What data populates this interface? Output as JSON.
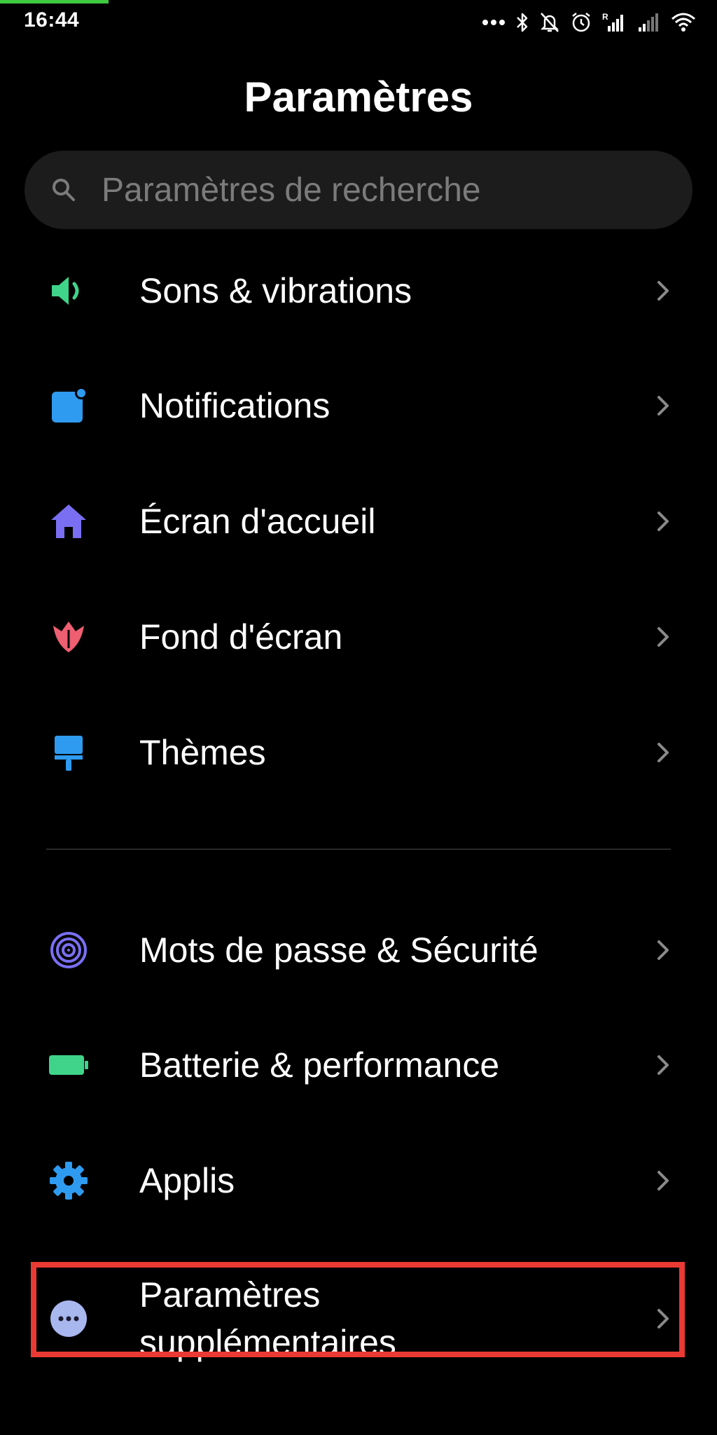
{
  "status_bar": {
    "time": "16:44",
    "icons": [
      "more-dots-icon",
      "bluetooth-icon",
      "bell-off-icon",
      "alarm-icon",
      "signal-r-icon",
      "signal-icon",
      "wifi-icon"
    ]
  },
  "title": "Paramètres",
  "search": {
    "placeholder": "Paramètres de recherche",
    "value": ""
  },
  "items": [
    {
      "label": "Sons & vibrations",
      "icon": "speaker-icon",
      "color": "#3fd48a"
    },
    {
      "label": "Notifications",
      "icon": "notification-square-icon",
      "color": "#2f9bf0"
    },
    {
      "label": "Écran d'accueil",
      "icon": "home-icon",
      "color": "#7a6ff2"
    },
    {
      "label": "Fond d'écran",
      "icon": "tulip-icon",
      "color": "#ee5f72"
    },
    {
      "label": "Thèmes",
      "icon": "paint-roller-icon",
      "color": "#2f9bf0"
    },
    {
      "label": "Mots de passe & Sécurité",
      "icon": "fingerprint-icon",
      "color": "#7a6ff2"
    },
    {
      "label": "Batterie & performance",
      "icon": "battery-icon",
      "color": "#3fd48a"
    },
    {
      "label": "Applis",
      "icon": "gear-icon",
      "color": "#2f9bf0"
    },
    {
      "label_line1": "Paramètres",
      "label_line2": "supplémentaires",
      "icon": "more-circle-icon",
      "color": "#a9b7ef"
    }
  ],
  "colors": {
    "background": "#000000",
    "highlight": "#ea3a33",
    "chevron": "#8a8a8a"
  }
}
